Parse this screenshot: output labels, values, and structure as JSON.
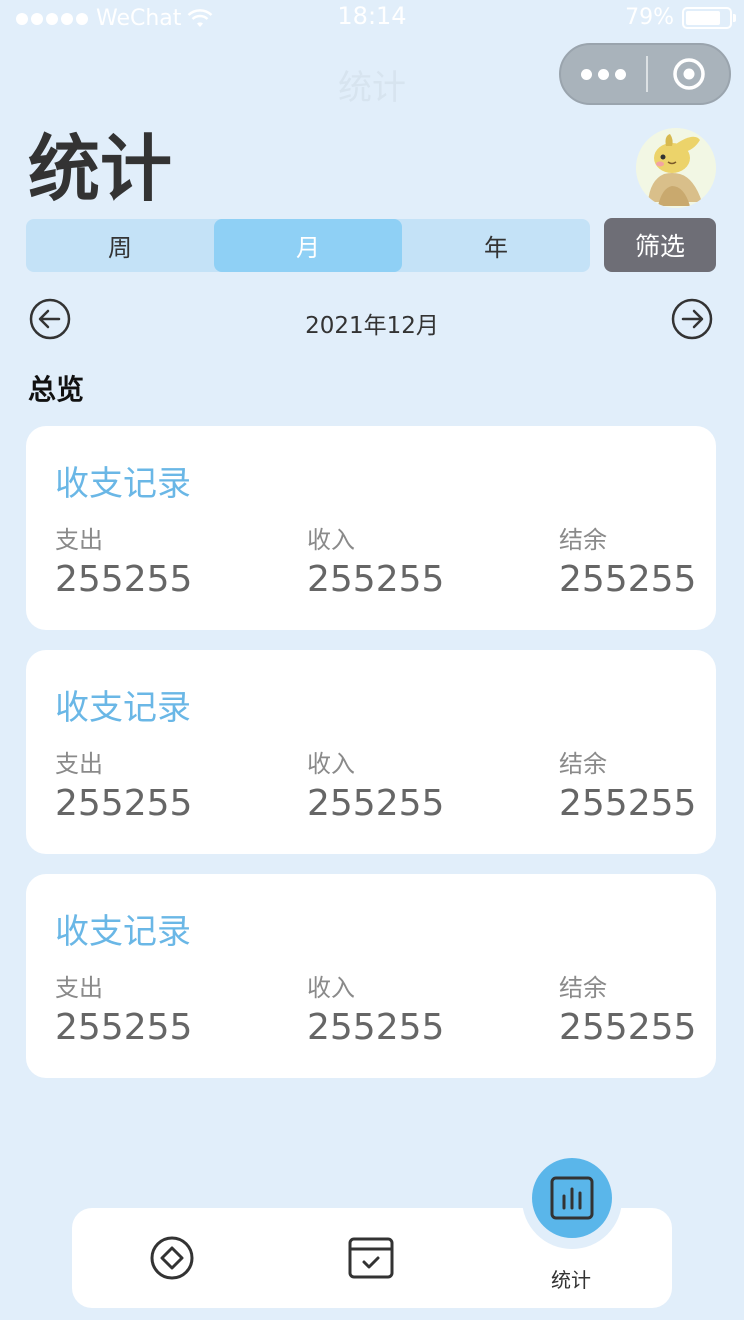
{
  "status_bar": {
    "carrier": "WeChat",
    "time": "18:14",
    "battery": "79%",
    "battery_level": 0.79
  },
  "nav": {
    "title": "统计"
  },
  "header": {
    "title": "统计"
  },
  "period_tabs": [
    {
      "label": "周",
      "active": false
    },
    {
      "label": "月",
      "active": true
    },
    {
      "label": "年",
      "active": false
    }
  ],
  "filter_label": "筛选",
  "date_nav": {
    "label": "2021年12月"
  },
  "section_title": "总览",
  "cards": [
    {
      "title": "收支记录",
      "expense_label": "支出",
      "expense": "255255",
      "income_label": "收入",
      "income": "255255",
      "balance_label": "结余",
      "balance": "255255"
    },
    {
      "title": "收支记录",
      "expense_label": "支出",
      "expense": "255255",
      "income_label": "收入",
      "income": "255255",
      "balance_label": "结余",
      "balance": "255255"
    },
    {
      "title": "收支记录",
      "expense_label": "支出",
      "expense": "255255",
      "income_label": "收入",
      "income": "255255",
      "balance_label": "结余",
      "balance": "255255"
    }
  ],
  "tabbar": {
    "home_icon": "diamond-circle-icon",
    "tasks_icon": "calendar-check-icon",
    "stats_icon": "bar-chart-icon",
    "stats_label": "统计"
  },
  "colors": {
    "background": "#e1eefa",
    "accent": "#5ab6ea",
    "card_title": "#6ab7e6",
    "segment_active": "#8fd0f5",
    "filter_button": "#6e6e76"
  }
}
